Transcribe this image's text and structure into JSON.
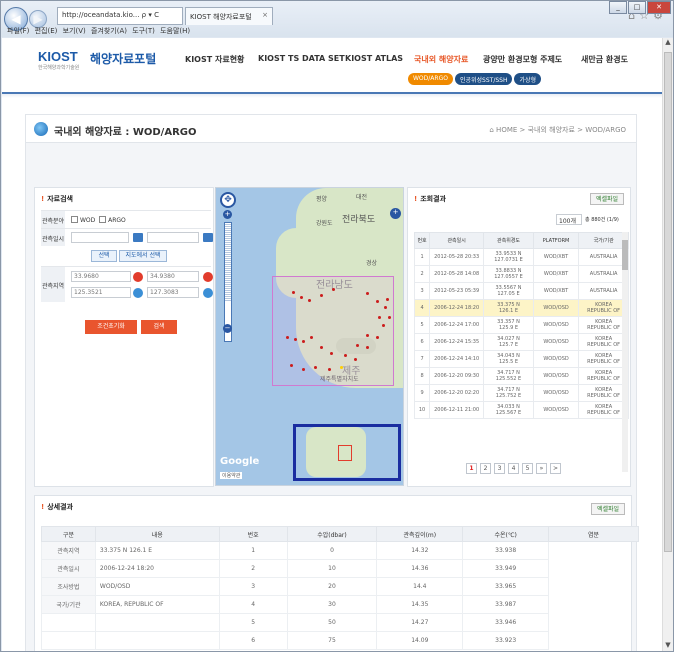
{
  "browser": {
    "url": "http://oceandata.kio... ρ ▾ C",
    "tab_title": "KIOST 해양자료포털",
    "menu": [
      "파일(F)",
      "편집(E)",
      "보기(V)",
      "즐겨찾기(A)",
      "도구(T)",
      "도움말(H)"
    ]
  },
  "header": {
    "logo": "KIOST",
    "logo_sub": "한국해양과학기술원",
    "site_name": "해양자료포털",
    "nav": [
      "KIOST 자료현황",
      "KIOST TS DATA SET",
      "KIOST ATLAS",
      "국내외 해양자료",
      "광양만 환경모형 주제도",
      "새만금 환경도"
    ],
    "sub": [
      "WOD/ARGO",
      "인공위성SST/SSH",
      "가상형"
    ]
  },
  "page": {
    "title": "국내외 해양자료 : WOD/ARGO",
    "breadcrumb": "⌂ HOME > 국내외 해양자료 > WOD/ARGO"
  },
  "search": {
    "title": "자료검색",
    "src_label": "관측분야",
    "opt1": "WOD",
    "opt2": "ARGO",
    "date_label": "관측일시",
    "area_label": "관측지역",
    "btn_select": "선택",
    "btn_map_select": "지도에서 선택",
    "lat1": "33.9680",
    "lat2": "34.9380",
    "lon1": "125.3521",
    "lon2": "127.3083",
    "btn_reset": "조건초기화",
    "btn_search": "검색"
  },
  "map": {
    "labels": [
      "평양",
      "대전",
      "강원도",
      "전라북도",
      "경상",
      "제주",
      "제주특별자치도",
      "전라남도"
    ],
    "google": "Google",
    "terms": "이용약관"
  },
  "results": {
    "title": "조회결과",
    "excel": "엑셀파일",
    "per_page": "100개",
    "count": "총 880건 (1/9)",
    "cols": [
      "번호",
      "관측일시",
      "관측위경도",
      "PLATFORM",
      "국가/기관"
    ],
    "rows": [
      [
        "1",
        "2012-05-28 20:33",
        "33.9533 N\n127.0731 E",
        "WOD/XBT",
        "AUSTRALIA"
      ],
      [
        "2",
        "2012-05-28 14:08",
        "33.8833 N\n127.0557 E",
        "WOD/XBT",
        "AUSTRALIA"
      ],
      [
        "3",
        "2012-05-23 05:39",
        "33.5567 N\n127.05 E",
        "WOD/XBT",
        "AUSTRALIA"
      ],
      [
        "4",
        "2006-12-24 18:20",
        "33.375 N\n126.1 E",
        "WOD/OSD",
        "KOREA\nREPUBLIC OF"
      ],
      [
        "5",
        "2006-12-24 17:00",
        "33.357 N\n125.9 E",
        "WOD/OSD",
        "KOREA\nREPUBLIC OF"
      ],
      [
        "6",
        "2006-12-24 15:35",
        "34.027 N\n125.7 E",
        "WOD/OSD",
        "KOREA\nREPUBLIC OF"
      ],
      [
        "7",
        "2006-12-24 14:10",
        "34.043 N\n125.5 E",
        "WOD/OSD",
        "KOREA\nREPUBLIC OF"
      ],
      [
        "8",
        "2006-12-20 09:30",
        "34.717 N\n125.552 E",
        "WOD/OSD",
        "KOREA\nREPUBLIC OF"
      ],
      [
        "9",
        "2006-12-20 02:20",
        "34.717 N\n125.752 E",
        "WOD/OSD",
        "KOREA\nREPUBLIC OF"
      ],
      [
        "10",
        "2006-12-11 21:00",
        "34.033 N\n125.567 E",
        "WOD/OSD",
        "KOREA\nREPUBLIC OF"
      ]
    ],
    "pages": [
      "1",
      "2",
      "3",
      "4",
      "5",
      "»",
      ">"
    ]
  },
  "detail": {
    "title": "상세결과",
    "excel": "엑셀파일",
    "cols": [
      "구분",
      "내용",
      "번호",
      "수압(dbar)",
      "관측깊이(m)",
      "수온(℃)",
      "염분"
    ],
    "info": [
      [
        "관측지역",
        "33.375 N 126.1 E"
      ],
      [
        "관측일시",
        "2006-12-24 18:20"
      ],
      [
        "조사방법",
        "WOD/OSD"
      ],
      [
        "국가/기관",
        "KOREA, REPUBLIC OF"
      ]
    ],
    "rows": [
      [
        "1",
        "",
        "0",
        "14.32",
        "33.938"
      ],
      [
        "2",
        "",
        "10",
        "14.36",
        "33.949"
      ],
      [
        "3",
        "",
        "20",
        "14.4",
        "33.965"
      ],
      [
        "4",
        "",
        "30",
        "14.35",
        "33.987"
      ],
      [
        "5",
        "",
        "50",
        "14.27",
        "33.946"
      ],
      [
        "6",
        "",
        "75",
        "14.09",
        "33.923"
      ]
    ]
  }
}
